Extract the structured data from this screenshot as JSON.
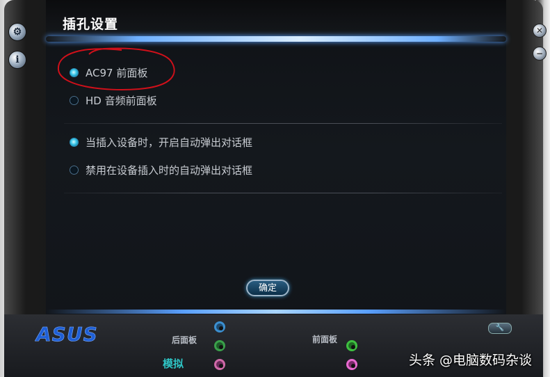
{
  "window": {
    "title": "插孔设置"
  },
  "front_panel": {
    "options": [
      {
        "label": "AC97 前面板",
        "selected": true
      },
      {
        "label": "HD 音频前面板",
        "selected": false
      }
    ]
  },
  "popup": {
    "options": [
      {
        "label": "当插入设备时，开启自动弹出对话框",
        "selected": true
      },
      {
        "label": "禁用在设备插入时的自动弹出对话框",
        "selected": false
      }
    ]
  },
  "buttons": {
    "ok": "确定"
  },
  "footer": {
    "brand": "ASUS",
    "rear_panel": "后面板",
    "front_panel": "前面板",
    "analog": "模拟",
    "jacks": {
      "rear": [
        "#3b8fd0",
        "#3aa04a",
        "#d06aa8"
      ],
      "front": [
        "#3ec040",
        "#e86ad0"
      ]
    }
  },
  "watermark": "头条 @电脑数码杂谈",
  "colors": {
    "accent": "#39c6e8",
    "glow": "#6fb0ff",
    "annotation": "#d0101a"
  }
}
